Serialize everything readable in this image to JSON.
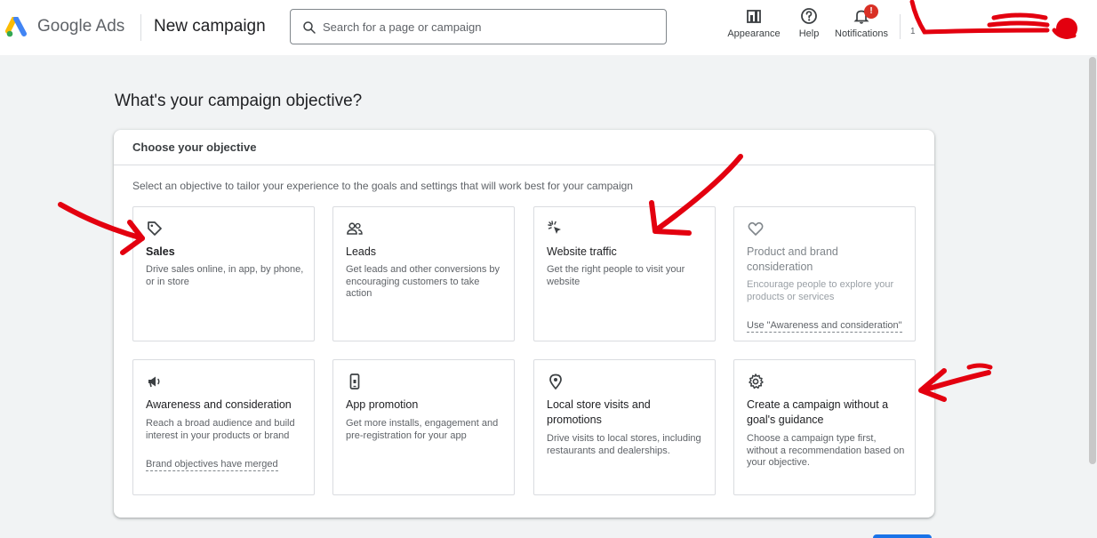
{
  "header": {
    "brand_google": "Google",
    "brand_ads": "Ads",
    "page_title": "New campaign",
    "search_placeholder": "Search for a page or campaign",
    "tools": {
      "appearance": "Appearance",
      "help": "Help",
      "notifications": "Notifications",
      "notification_badge": "!"
    },
    "account_fragment": "1"
  },
  "main": {
    "heading": "What's your campaign objective?",
    "card_title": "Choose your objective",
    "card_description": "Select an objective to tailor your experience to the goals and settings that will work best for your campaign",
    "objectives": [
      {
        "icon": "tag-icon",
        "title": "Sales",
        "description": "Drive sales online, in app, by phone, or in store"
      },
      {
        "icon": "people-icon",
        "title": "Leads",
        "description": "Get leads and other conversions by encouraging customers to take action"
      },
      {
        "icon": "cursor-click-icon",
        "title": "Website traffic",
        "description": "Get the right people to visit your website"
      },
      {
        "icon": "heart-icon",
        "title": "Product and brand consideration",
        "description": "Encourage people to explore your products or services",
        "link": "Use \"Awareness and consideration\""
      },
      {
        "icon": "megaphone-icon",
        "title": "Awareness and consideration",
        "description": "Reach a broad audience and build interest in your products or brand",
        "link": "Brand objectives have merged"
      },
      {
        "icon": "phone-icon",
        "title": "App promotion",
        "description": "Get more installs, engagement and pre-registration for your app"
      },
      {
        "icon": "location-pin-icon",
        "title": "Local store visits and promotions",
        "description": "Drive visits to local stores, including restaurants and dealerships."
      },
      {
        "icon": "gear-icon",
        "title": "Create a campaign without a goal's guidance",
        "description": "Choose a campaign type first, without a recommendation based on your objective."
      }
    ]
  },
  "colors": {
    "background": "#f1f3f4",
    "accent": "#1a73e8",
    "badge": "#d93025",
    "annotation": "#e3000f"
  }
}
